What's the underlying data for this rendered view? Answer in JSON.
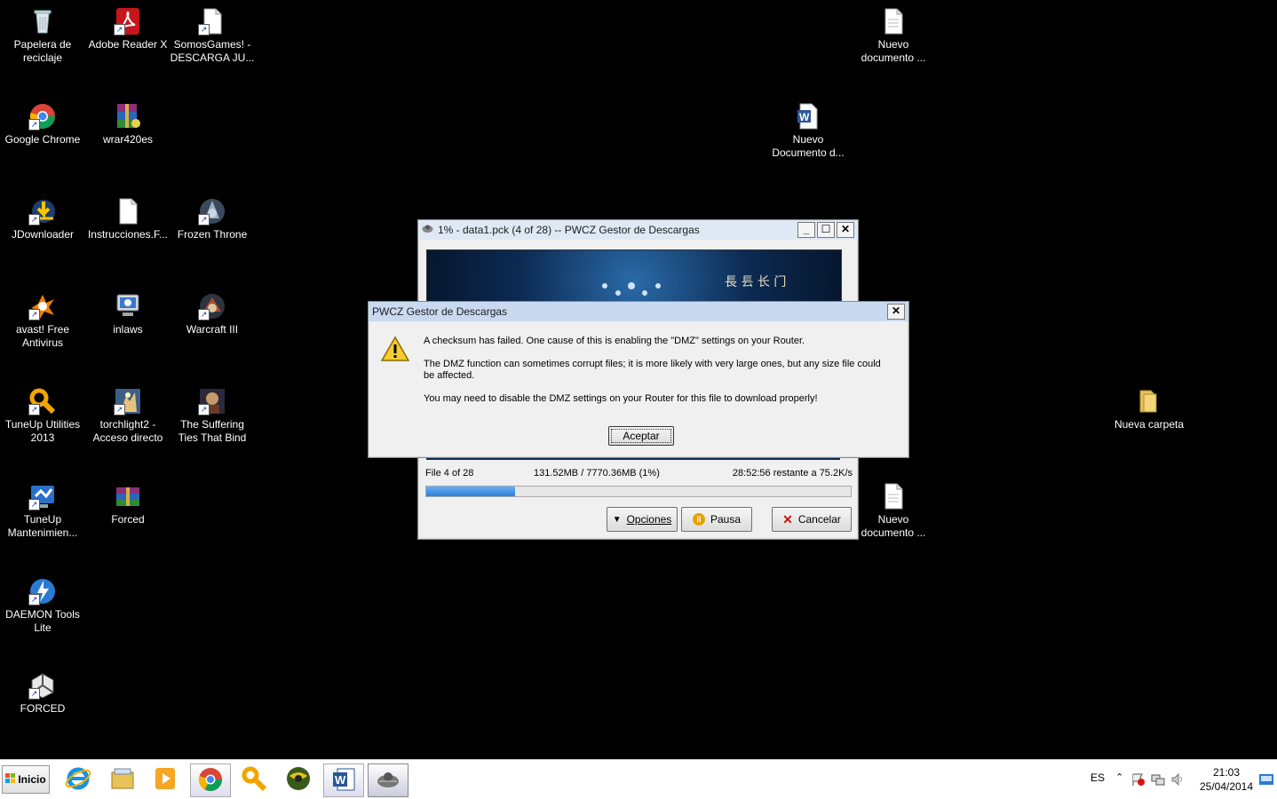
{
  "desktop_icons": [
    {
      "label": "Papelera de\nreciclaje",
      "icon": "recycle-bin-icon"
    },
    {
      "label": "Adobe Reader X",
      "icon": "adobe-reader-icon"
    },
    {
      "label": "SomosGames! -\nDESCARGA JU...",
      "icon": "document-icon"
    },
    {
      "label": "Google Chrome",
      "icon": "chrome-icon"
    },
    {
      "label": "wrar420es",
      "icon": "winrar-icon"
    },
    {
      "label": "JDownloader",
      "icon": "jdownloader-icon"
    },
    {
      "label": "Instrucciones.F...",
      "icon": "document-icon"
    },
    {
      "label": "Frozen Throne",
      "icon": "warcraft-icon"
    },
    {
      "label": "avast! Free\nAntivirus",
      "icon": "avast-icon"
    },
    {
      "label": "inlaws",
      "icon": "computer-icon"
    },
    {
      "label": "Warcraft III",
      "icon": "warcraft-icon"
    },
    {
      "label": "TuneUp Utilities\n2013",
      "icon": "tuneup-icon"
    },
    {
      "label": "torchlight2 -\nAcceso directo",
      "icon": "torchlight-icon"
    },
    {
      "label": "The Suffering\nTies That Bind",
      "icon": "game-icon"
    },
    {
      "label": "TuneUp\nMantenimien...",
      "icon": "tuneup-maintenance-icon"
    },
    {
      "label": "Forced",
      "icon": "winrar-archive-icon"
    },
    {
      "label": "DAEMON Tools\nLite",
      "icon": "daemon-tools-icon"
    },
    {
      "label": "FORCED",
      "icon": "unity-icon"
    },
    {
      "label": "Nuevo\ndocumento ...",
      "icon": "document-icon"
    },
    {
      "label": "Nuevo\nDocumento d...",
      "icon": "word-document-icon"
    },
    {
      "label": "Nueva carpeta",
      "icon": "folder-icon"
    },
    {
      "label": "Nuevo\ndocumento ...",
      "icon": "document-icon"
    }
  ],
  "download_window": {
    "title": "1% - data1.pck (4 of 28) -- PWCZ Gestor de Descargas",
    "file_count": "File 4 of 28",
    "size_progress": "131.52MB / 7770.36MB (1%)",
    "time_remaining": "28:52:56 restante a 75.2K/s",
    "progress_percent": 1,
    "buttons": {
      "options": "Opciones",
      "pause": "Pausa",
      "cancel": "Cancelar"
    }
  },
  "dialog": {
    "title": "PWCZ Gestor de Descargas",
    "message1": "A checksum has failed.  One cause of this is enabling the \"DMZ\" settings on your Router.",
    "message2": "The DMZ function can sometimes corrupt files; it is more likely with very large ones, but any size file could be affected.",
    "message3": "You may need to disable the DMZ settings on your Router for this file to download properly!",
    "ok_label": "Aceptar"
  },
  "taskbar": {
    "start_label": "Inicio",
    "language": "ES",
    "time": "21:03",
    "date": "25/04/2014",
    "apps": [
      "internet-explorer-icon",
      "file-explorer-icon",
      "media-player-icon",
      "chrome-icon",
      "tuneup-icon",
      "game-globe-icon",
      "word-icon",
      "pwcz-icon"
    ]
  },
  "colors": {
    "desktop": "#000000",
    "titlebar_inactive": "#dfe9f5",
    "progress": "#3c8fe6",
    "dialog_titlebar": "#c9daf0"
  }
}
